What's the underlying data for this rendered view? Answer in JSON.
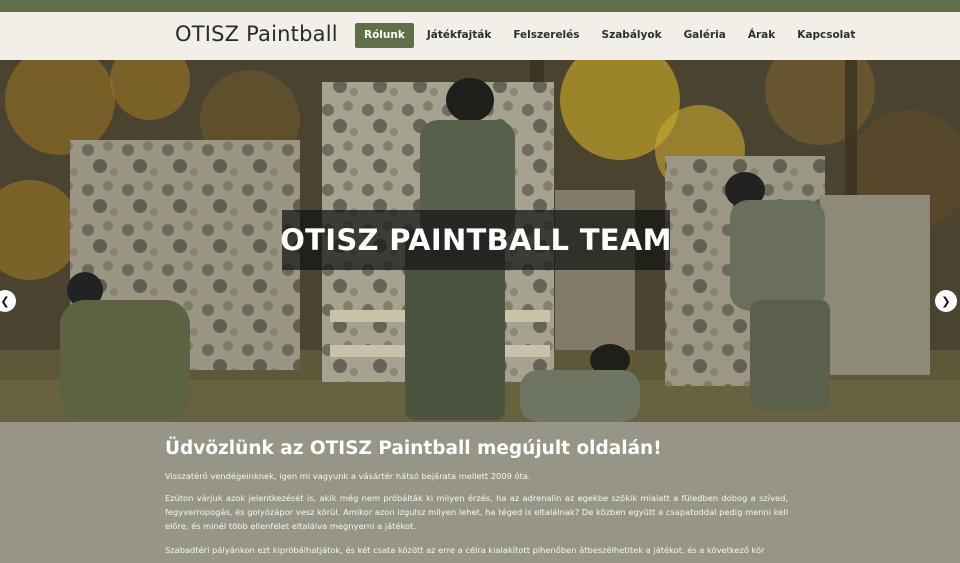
{
  "brand": {
    "title": "OTISZ Paintball"
  },
  "nav": {
    "items": [
      {
        "label": "Rólunk",
        "active": true
      },
      {
        "label": "Játékfajták",
        "active": false
      },
      {
        "label": "Felszerelés",
        "active": false
      },
      {
        "label": "Szabályok",
        "active": false
      },
      {
        "label": "Galéria",
        "active": false
      },
      {
        "label": "Árak",
        "active": false
      },
      {
        "label": "Kapcsolat",
        "active": false
      }
    ]
  },
  "hero": {
    "title": "OTISZ PAINTBALL TEAM",
    "prev_icon": "chevron-left-icon",
    "next_icon": "chevron-right-icon"
  },
  "content": {
    "heading": "Üdvözlünk az OTISZ Paintball megújult oldalán!",
    "paragraphs": [
      "Visszatérő vendégeinknek, igen mi vagyunk a vásártér hátsó bejárata mellett 2009 óta.",
      "Ezúton várjuk azok jelentkezését is, akik még nem próbálták ki milyen érzés, ha az adrenalin az egekbe szökik mialatt a füledben dobog a szíved, fegyverropogás, és golyózápor vesz körül. Amikor azon izgulsz milyen lehet, ha téged is eltalálnak? De közben együtt a csapatoddal pedig menni kell előre, és minél több ellenfelet eltalálva megnyerni a játékot.",
      "Szabadtéri pályánkon ezt kipróbálhatjátok, és két csata között az erre a célra kialakított pihenőben átbeszélhetitek a játékot, és a következő kör"
    ]
  },
  "colors": {
    "accent": "#5f6f47",
    "header_bg": "#f1efe8",
    "content_bg": "#969587"
  }
}
